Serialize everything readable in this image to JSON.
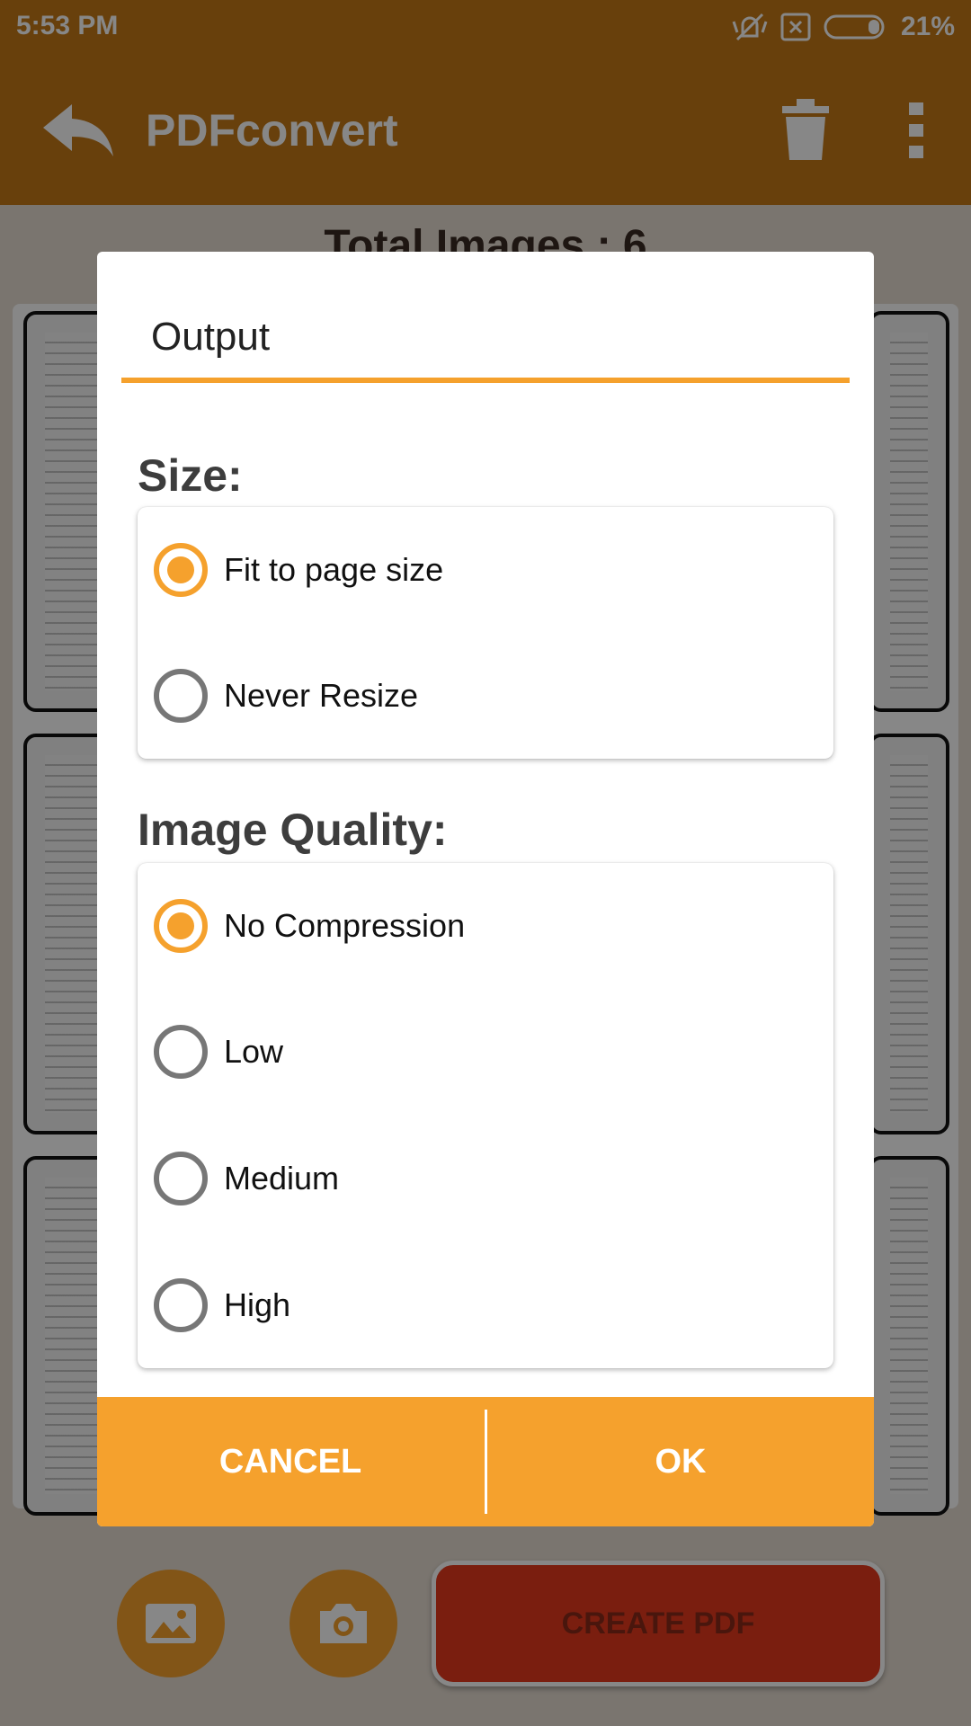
{
  "status_bar": {
    "time": "5:53 PM",
    "battery_percent": "21%",
    "icons": [
      "mute-vibrate-icon",
      "no-sim-icon",
      "battery-icon"
    ]
  },
  "app_bar": {
    "title": "PDFconvert",
    "icons": [
      "back-arrow-icon",
      "trash-icon",
      "more-vert-icon"
    ]
  },
  "content": {
    "total_images": "Total Images : 6",
    "create_pdf_label": "CREATE PDF",
    "fab_icons": [
      "gallery-icon",
      "camera-icon"
    ]
  },
  "dialog": {
    "title": "Output",
    "size_section": {
      "label": "Size:",
      "options": [
        {
          "label": "Fit to page size",
          "selected": true
        },
        {
          "label": "Never Resize",
          "selected": false
        }
      ]
    },
    "quality_section": {
      "label": "Image Quality:",
      "options": [
        {
          "label": "No Compression",
          "selected": true
        },
        {
          "label": "Low",
          "selected": false
        },
        {
          "label": "Medium",
          "selected": false
        },
        {
          "label": "High",
          "selected": false
        }
      ]
    },
    "cancel_label": "CANCEL",
    "ok_label": "OK"
  },
  "colors": {
    "accent": "#f5a12d",
    "app_bar": "#c57a17",
    "create_pdf": "#e63a1e"
  }
}
